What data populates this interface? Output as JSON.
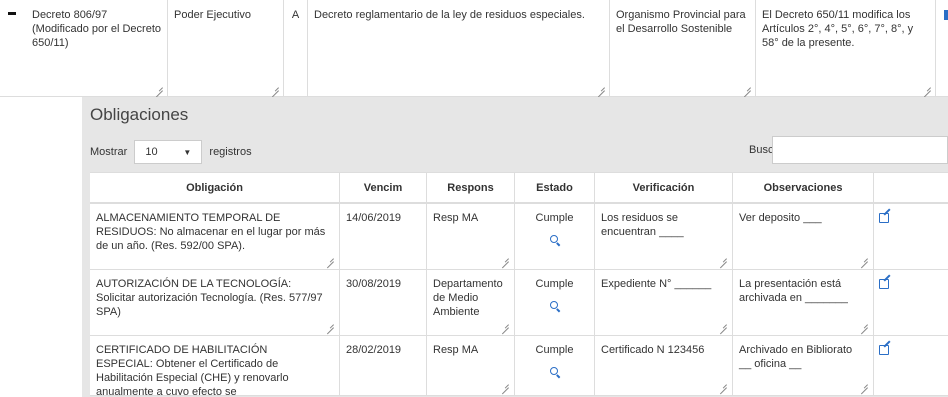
{
  "decree": {
    "name": "Decreto 806/97 (Modificado por el Decreto 650/11)",
    "authority": "Poder Ejecutivo",
    "type": "A",
    "description": "Decreto reglamentario de la ley de residuos especiales.",
    "organism": "Organismo Provincial para el Desarrollo Sostenible",
    "note": "El Decreto 650/11 modifica los Artículos 2°, 4°, 5°, 6°, 7°, 8°, y 58° de la presente."
  },
  "obligations": {
    "title": "Obligaciones",
    "show_label": "Mostrar",
    "page_size": "10",
    "records_label": "registros",
    "search_label": "Buscar:",
    "search_value": "",
    "columns": [
      "Obligación",
      "Vencim",
      "Respons",
      "Estado",
      "Verificación",
      "Observaciones"
    ],
    "rows": [
      {
        "obligation": "ALMACENAMIENTO TEMPORAL DE RESIDUOS: No almacenar en el lugar por más de un año. (Res. 592/00 SPA).",
        "due": "14/06/2019",
        "responsible": "Resp MA",
        "status": "Cumple",
        "verification": "Los residuos  se encuentran ____",
        "observations": "Ver deposito ___"
      },
      {
        "obligation": "AUTORIZACIÓN DE LA TECNOLOGÍA: Solicitar autorización Tecnología. (Res. 577/97 SPA)",
        "due": "30/08/2019",
        "responsible": "Departamento de Medio Ambiente",
        "status": "Cumple",
        "verification": "Expediente N° ______",
        "observations": "La presentación está archivada en _______"
      },
      {
        "obligation": "CERTIFICADO DE HABILITACIÓN ESPECIAL: Obtener el Certificado de Habilitación Especial (CHE) y renovarlo anualmente a cuyo efecto se",
        "due": "28/02/2019",
        "responsible": "Resp MA",
        "status": "Cumple",
        "verification": "Certificado N 123456",
        "observations": "Archivado en Bibliorato __ oficina __"
      }
    ]
  },
  "colors": {
    "accent": "#2a6ec6",
    "panel_bg": "#e6e6e6",
    "border": "#dddddd"
  }
}
